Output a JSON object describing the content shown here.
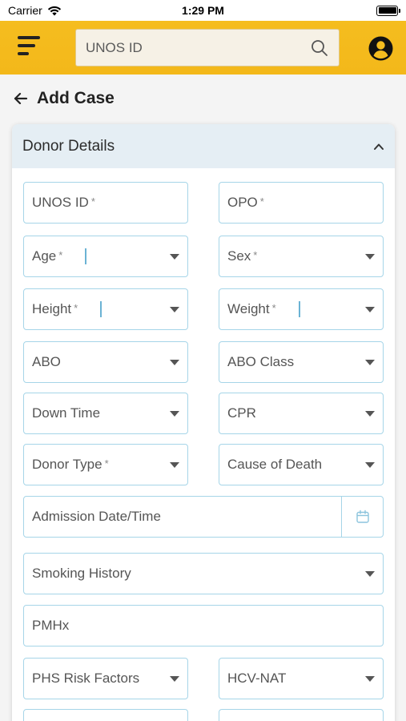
{
  "status_bar": {
    "carrier": "Carrier",
    "time": "1:29 PM",
    "battery_level": 1.0
  },
  "header": {
    "search_placeholder": "UNOS ID",
    "accent_color": "#f5bd1f",
    "icons": {
      "menu": "menu-icon",
      "search": "search-icon",
      "profile": "account-circle-icon"
    }
  },
  "page": {
    "title": "Add Case",
    "back_icon": "arrow-left-icon"
  },
  "section": {
    "title": "Donor Details",
    "expanded": true,
    "fields": {
      "unos_id": {
        "label": "UNOS ID",
        "required_mark": "*"
      },
      "opo": {
        "label": "OPO",
        "required_mark": "*"
      },
      "age": {
        "label": "Age",
        "required_mark": "*"
      },
      "sex": {
        "label": "Sex",
        "required_mark": "*"
      },
      "height": {
        "label": "Height",
        "required_mark": "*"
      },
      "weight": {
        "label": "Weight",
        "required_mark": "*"
      },
      "abo": {
        "label": "ABO"
      },
      "abo_class": {
        "label": "ABO Class"
      },
      "down_time": {
        "label": "Down Time"
      },
      "cpr": {
        "label": "CPR"
      },
      "donor_type": {
        "label": "Donor Type",
        "required_mark": "*"
      },
      "cause_of_death": {
        "label": "Cause of Death"
      },
      "admission_date_time": {
        "label": "Admission Date/Time"
      },
      "smoking_history": {
        "label": "Smoking History"
      },
      "pmhx": {
        "label": "PMHx"
      },
      "phs_risk_factors": {
        "label": "PHS Risk Factors"
      },
      "hcv_nat": {
        "label": "HCV-NAT"
      }
    }
  },
  "colors": {
    "field_border": "#a6d5e8",
    "section_header_bg": "#e5eef4"
  }
}
